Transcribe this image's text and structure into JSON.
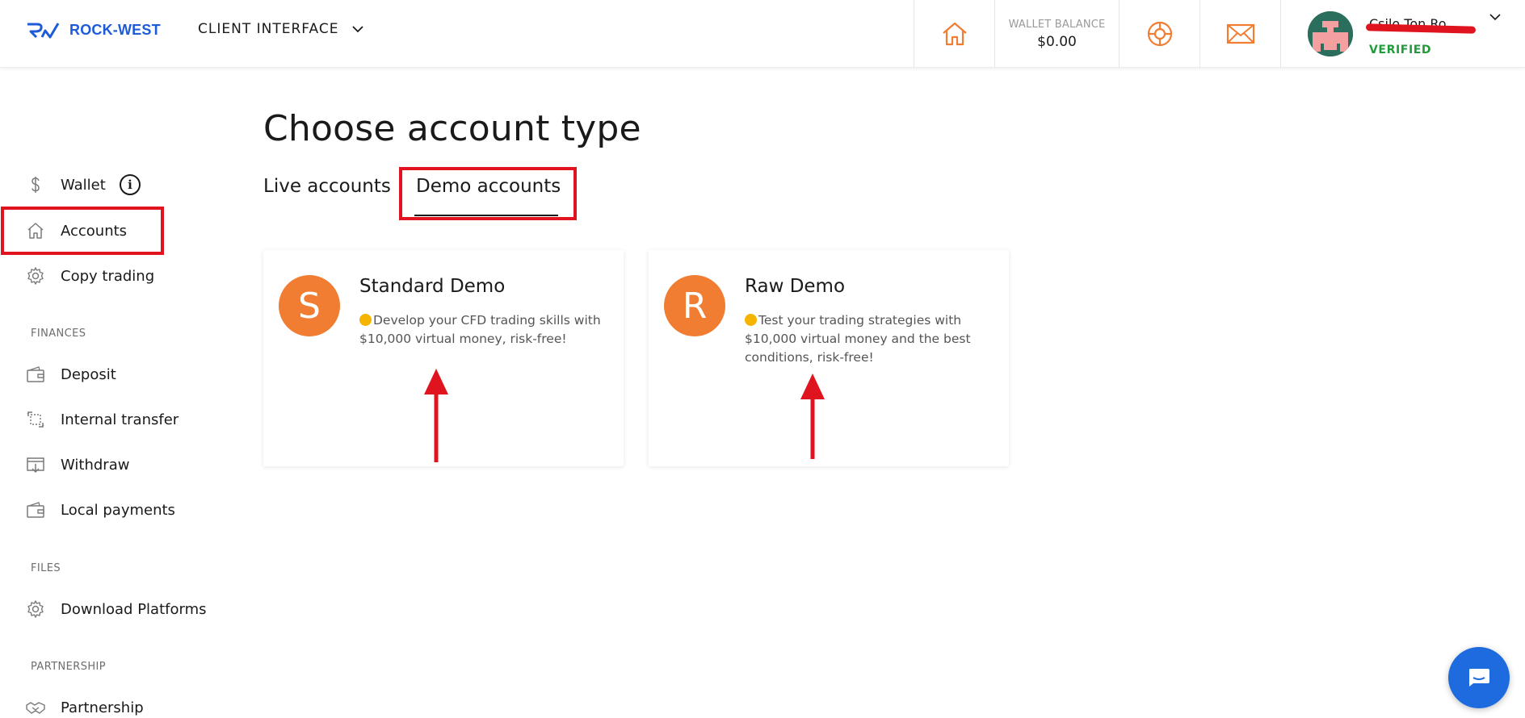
{
  "header": {
    "logo_text": "ROCK-WEST",
    "client_interface": "CLIENT INTERFACE",
    "wallet_balance_label": "WALLET BALANCE",
    "wallet_balance_value": "$0.00",
    "user_name": "Csilo Ton Ro",
    "user_status": "VERIFIED"
  },
  "sidebar": {
    "items": [
      {
        "label": "Wallet",
        "icon": "dollar-icon"
      },
      {
        "label": "Accounts",
        "icon": "home-icon"
      },
      {
        "label": "Copy trading",
        "icon": "gear-icon"
      }
    ],
    "finances_title": "FINANCES",
    "finances": [
      {
        "label": "Deposit",
        "icon": "wallet-icon"
      },
      {
        "label": "Internal transfer",
        "icon": "transfer-icon"
      },
      {
        "label": "Withdraw",
        "icon": "withdraw-icon"
      },
      {
        "label": "Local payments",
        "icon": "wallet-icon"
      }
    ],
    "files_title": "FILES",
    "files": [
      {
        "label": "Download Platforms",
        "icon": "gear-icon"
      }
    ],
    "partnership_title": "PARTNERSHIP",
    "partnership": [
      {
        "label": "Partnership",
        "icon": "handshake-icon"
      }
    ]
  },
  "main": {
    "title": "Choose account type",
    "tabs": [
      {
        "label": "Live accounts",
        "active": false
      },
      {
        "label": "Demo accounts",
        "active": true
      }
    ],
    "cards": [
      {
        "letter": "S",
        "title": "Standard Demo",
        "description": "Develop your CFD trading skills with $10,000 virtual money, risk-free!"
      },
      {
        "letter": "R",
        "title": "Raw Demo",
        "description": "Test your trading strategies with $10,000 virtual money and the best conditions, risk-free!"
      }
    ]
  },
  "colors": {
    "brand_blue": "#1e5bd8",
    "accent_orange": "#f07d32",
    "verified_green": "#1f9d3a",
    "annotation_red": "#e0141e",
    "chat_blue": "#1e6be0"
  }
}
